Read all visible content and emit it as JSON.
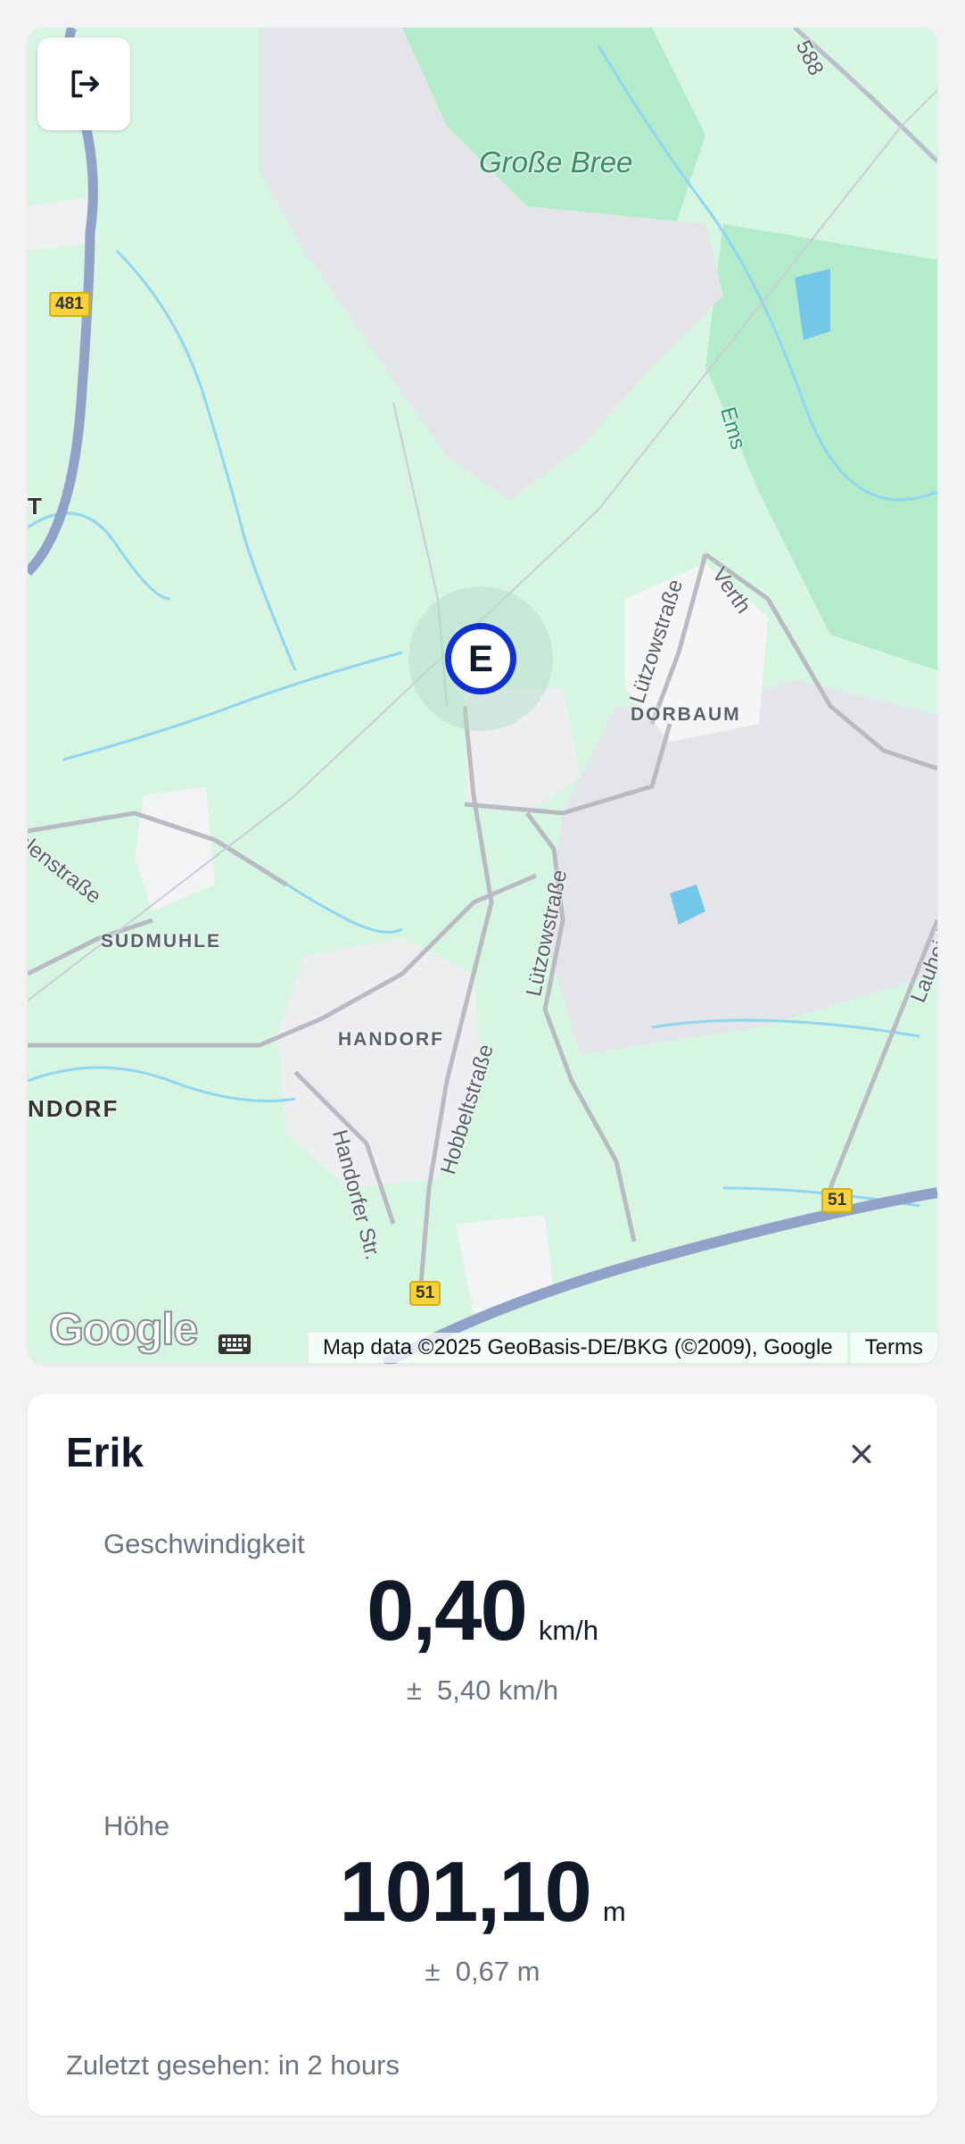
{
  "map": {
    "places": {
      "grosse_bree": "Große Bree",
      "dorbaum": "DORBAUM",
      "sudmuhle": "SUDMUHLE",
      "handorf": "HANDORF",
      "ndorf": "NDORF",
      "ems": "Ems",
      "t": "T"
    },
    "streets": {
      "luetzowstrasse_upper": "Lützowstraße",
      "luetzowstrasse_lower": "Lützowstraße",
      "verth": "Verth",
      "hobbeltstrasse": "Hobbeltstraße",
      "handorfer_str": "Handorfer Str.",
      "lauheide": "Lauheide",
      "wuehlenstrasse": "hlenstraße",
      "r588": "588"
    },
    "road_shields": [
      "481",
      "51",
      "51"
    ],
    "marker_letter": "E",
    "google_logo": "Google",
    "attribution": "Map data ©2025 GeoBasis-DE/BKG (©2009), Google",
    "terms": "Terms",
    "exit_icon": "logout-icon",
    "colors": {
      "land": "#d6f5e3",
      "forest": "#b3ebcb",
      "urban": "#e3e5e8",
      "water": "#74c7e8",
      "road": "#8fa3c8",
      "marker": "#1130d0"
    }
  },
  "info": {
    "name": "Erik",
    "close_icon": "close-icon",
    "speed": {
      "label": "Geschwindigkeit",
      "value": "0,40",
      "unit": "km/h",
      "accuracy": "±  5,40 km/h"
    },
    "altitude": {
      "label": "Höhe",
      "value": "101,10",
      "unit": "m",
      "accuracy": "±  0,67 m"
    },
    "last_seen": "Zuletzt gesehen: in 2 hours"
  }
}
